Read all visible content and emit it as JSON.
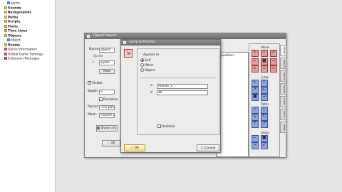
{
  "tree": {
    "items": [
      {
        "label": "sprite",
        "kind": "sprite",
        "indent": 2,
        "bold": false
      },
      {
        "label": "Sounds",
        "kind": "folder",
        "indent": 1,
        "bold": true
      },
      {
        "label": "Backgrounds",
        "kind": "folder",
        "indent": 1,
        "bold": true
      },
      {
        "label": "Paths",
        "kind": "folder",
        "indent": 1,
        "bold": true
      },
      {
        "label": "Scripts",
        "kind": "folder",
        "indent": 1,
        "bold": true
      },
      {
        "label": "Fonts",
        "kind": "folder",
        "indent": 1,
        "bold": true
      },
      {
        "label": "Time Lines",
        "kind": "folder",
        "indent": 1,
        "bold": true
      },
      {
        "label": "Objects",
        "kind": "folder",
        "indent": 1,
        "bold": true
      },
      {
        "label": "object",
        "kind": "object",
        "indent": 2,
        "bold": false
      },
      {
        "label": "Rooms",
        "kind": "folder",
        "indent": 1,
        "bold": true
      },
      {
        "label": "Game Information",
        "kind": "config",
        "indent": 1,
        "bold": false
      },
      {
        "label": "Global Game Settings",
        "kind": "config",
        "indent": 1,
        "bold": false
      },
      {
        "label": "Extension Packages",
        "kind": "config",
        "indent": 1,
        "bold": false
      }
    ]
  },
  "object_window": {
    "title": "Object Propert",
    "name_label": "Name:",
    "name_value": "object",
    "sprite_label": "Sprite",
    "sprite_value": "sprite",
    "new_button": "New",
    "visible_label": "Visible",
    "depth_label": "Depth:",
    "depth_value": "0",
    "persistent_label": "Persisten",
    "parent_label": "Parent:",
    "parent_value": "<no paren",
    "mask_label": "Mask:",
    "mask_value": "<same as s",
    "show_info_button": "Show Info",
    "ok_button": "OK",
    "event_item": "position",
    "palette_groups": [
      "Move",
      "Jump",
      "Paths",
      "Steps"
    ],
    "tabs": [
      "move",
      "main1",
      "main2",
      "control",
      "score",
      "extra",
      "draw"
    ]
  },
  "jump_dialog": {
    "title": "Jump to Position",
    "applies_to_label": "Applies to",
    "applies_options": [
      "Self",
      "Other",
      "Object"
    ],
    "applies_selected": "Self",
    "x_label": "x:",
    "x_value": "mouse_x",
    "y_label": "y:",
    "y_value": "46",
    "relative_label": "Relative",
    "relative_checked": false,
    "ok_button": "OK",
    "cancel_button": "Cancel"
  }
}
